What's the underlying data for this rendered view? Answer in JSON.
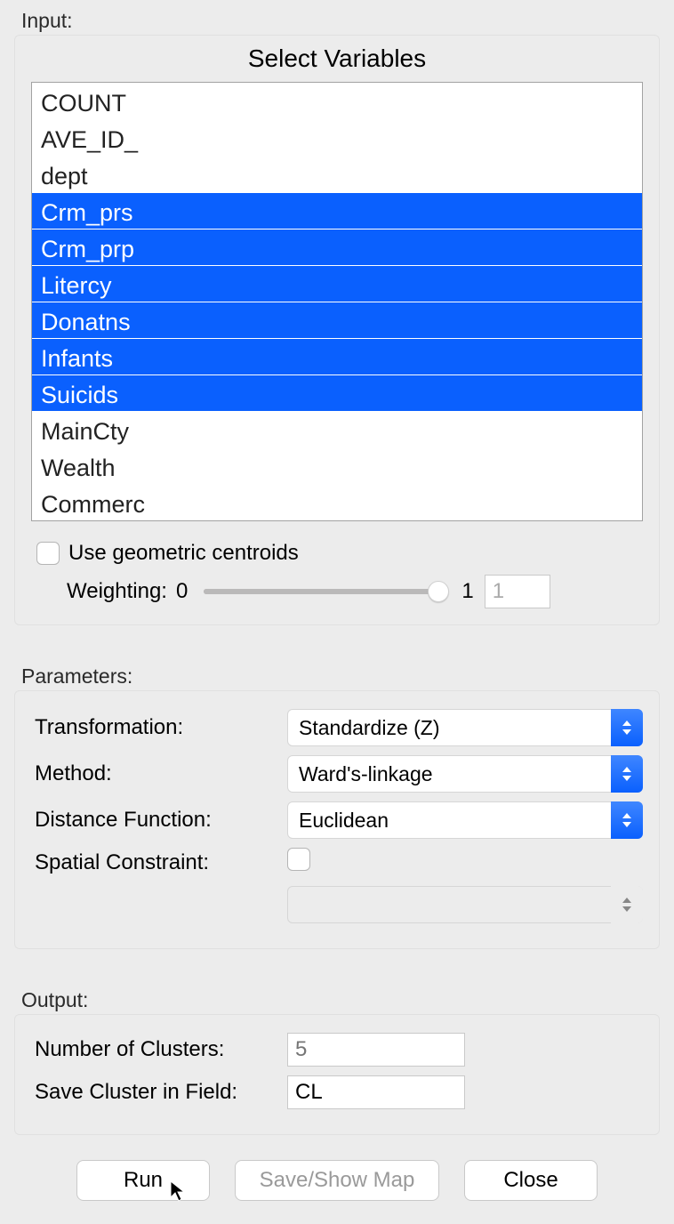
{
  "input": {
    "section_label": "Input:",
    "title": "Select Variables",
    "items": [
      {
        "label": "COUNT",
        "selected": false
      },
      {
        "label": "AVE_ID_",
        "selected": false
      },
      {
        "label": "dept",
        "selected": false
      },
      {
        "label": "Crm_prs",
        "selected": true
      },
      {
        "label": "Crm_prp",
        "selected": true
      },
      {
        "label": "Litercy",
        "selected": true
      },
      {
        "label": "Donatns",
        "selected": true
      },
      {
        "label": "Infants",
        "selected": true
      },
      {
        "label": "Suicids",
        "selected": true
      },
      {
        "label": "MainCty",
        "selected": false
      },
      {
        "label": "Wealth",
        "selected": false
      },
      {
        "label": "Commerc",
        "selected": false
      }
    ],
    "use_centroids_label": "Use geometric centroids",
    "use_centroids_checked": false,
    "weighting_label": "Weighting:",
    "weighting_min": "0",
    "weighting_max": "1",
    "weighting_value": "1",
    "weighting_position": 1.0
  },
  "parameters": {
    "section_label": "Parameters:",
    "rows": {
      "transformation": {
        "label": "Transformation:",
        "value": "Standardize (Z)",
        "enabled": true
      },
      "method": {
        "label": "Method:",
        "value": "Ward's-linkage",
        "enabled": true
      },
      "distance": {
        "label": "Distance Function:",
        "value": "Euclidean",
        "enabled": true
      },
      "spatial": {
        "label": "Spatial Constraint:",
        "value": "",
        "enabled": false
      }
    },
    "spatial_checked": false
  },
  "output": {
    "section_label": "Output:",
    "num_clusters_label": "Number of Clusters:",
    "num_clusters_placeholder": "5",
    "save_field_label": "Save Cluster in Field:",
    "save_field_value": "CL"
  },
  "buttons": {
    "run": "Run",
    "save_show": "Save/Show Map",
    "close": "Close"
  }
}
